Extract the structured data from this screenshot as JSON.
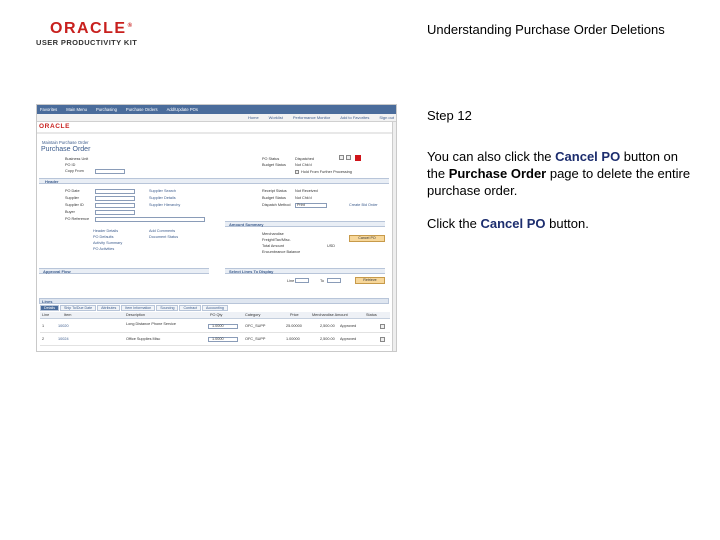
{
  "logo": {
    "brand": "ORACLE",
    "registered": "®",
    "product": "USER PRODUCTIVITY KIT"
  },
  "document_title": "Understanding Purchase Order Deletions",
  "step_label": "Step 12",
  "instruction": {
    "p1_a": "You can also click the ",
    "p1_b": "Cancel PO",
    "p1_c": " button on the ",
    "p1_d": "Purchase Order",
    "p1_e": " page to delete the entire purchase order.",
    "p2_a": "Click the ",
    "p2_b": "Cancel PO",
    "p2_c": " button."
  },
  "screenshot": {
    "nav": [
      "Favorites",
      "Main Menu",
      "Purchasing",
      "Purchase Orders",
      "Add/Update POs"
    ],
    "subnav": [
      "Home",
      "Worklist",
      "Performance Monitor",
      "Add to Favorites",
      "Sign out"
    ],
    "brand": "ORACLE",
    "breadcrumb": "Maintain Purchase Order",
    "page_title": "Purchase Order",
    "header": {
      "business_unit_label": "Business Unit",
      "po_status_label": "PO Status",
      "po_status": "Dispatched",
      "copy_from_label": "Copy From",
      "budget_status_label": "Budget Status",
      "budget_status": "Not Chk'd",
      "header_label": "Header",
      "po_date_label": "PO Date",
      "supplier_label": "Supplier",
      "supplier_id_label": "Supplier ID",
      "buyer_label": "Buyer",
      "po_reference_label": "PO Reference",
      "supplier_search": "Supplier Search",
      "supplier_details": "Supplier Details",
      "supplier_hierarchy": "Supplier Hierarchy",
      "hold_from_processing": "Hold From Further Processing",
      "create_bid_order": "Create Bid Order",
      "receipt_status_label": "Receipt Status",
      "receipt_status": "Not Received",
      "dispatch_method_label": "Dispatch Method",
      "dispatch_method": "Print",
      "budget_status2_label": "Budget Status",
      "budget_status2": "Not Chk'd",
      "header_details": "Header Details",
      "po_defaults": "PO Defaults",
      "activity_summary": "Activity Summary",
      "po_activities": "PO Activities",
      "add_comments": "Add Comments",
      "document_status": "Document Status",
      "amount_summary": "Amount Summary",
      "merchandise_label": "Merchandise",
      "freight_label": "Freight/Tax/Misc.",
      "total_amount_label": "Total Amount",
      "encumbrance_balance_label": "Encumbrance Balance",
      "currency": "USD",
      "cancel_po_btn": "Cancel PO",
      "approval_flow": "Approval Flow",
      "select_lines": "Select Lines To Display",
      "line_label": "Line",
      "to_label": "To",
      "retrieve_btn": "Retrieve"
    },
    "lines_title": "Lines",
    "tabs": [
      "Details",
      "Ship To/Due Date",
      "Attributes",
      "Item Information",
      "Sourcing",
      "Contract",
      "Accounting"
    ],
    "columns": [
      "Line",
      "Item",
      "Description",
      "PO Qty",
      "Category",
      "Price",
      "Merchandise Amount",
      "Status"
    ],
    "rows": [
      {
        "line": "1",
        "item": "10020",
        "desc": "Long Distance Phone Service",
        "qty": "1.0000",
        "cat": "OFC_SUPP",
        "price": "25.00000",
        "amount": "2,500.00",
        "status": "Approved"
      },
      {
        "line": "2",
        "item": "10024",
        "desc": "Office Supplies Misc",
        "qty": "1.0000",
        "cat": "OFC_SUPP",
        "price": "1.00000",
        "amount": "2,500.00",
        "status": "Approved"
      }
    ]
  }
}
